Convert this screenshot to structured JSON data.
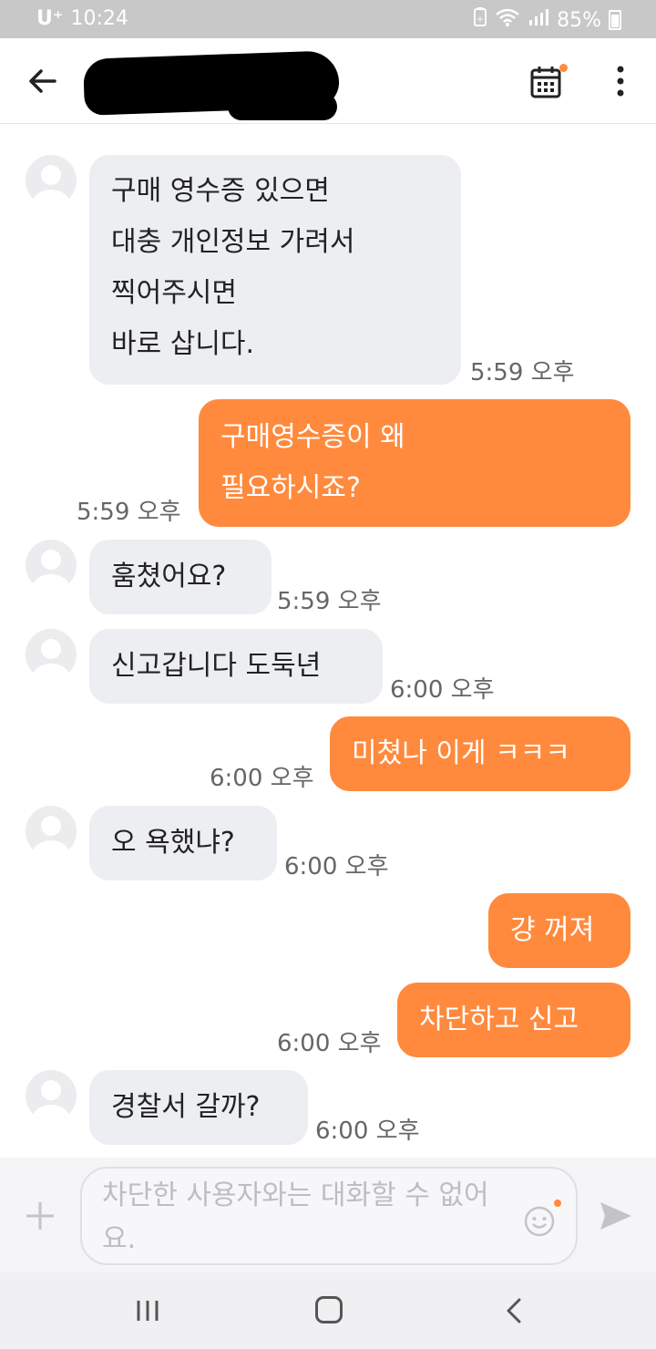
{
  "status_bar": {
    "carrier": "U⁺",
    "time": "10:24",
    "battery": "85%"
  },
  "header": {
    "back_label": "back",
    "title": ""
  },
  "messages": [
    {
      "side": "in",
      "text": "구매 영수증 있으면\n대충 개인정보 가려서\n찍어주시면\n바로 삽니다.",
      "time": "5:59 오후"
    },
    {
      "side": "out",
      "text": "구매영수증이 왜\n필요하시죠?",
      "time": "5:59 오후"
    },
    {
      "side": "in",
      "text": "훔쳤어요?",
      "time": "5:59 오후"
    },
    {
      "side": "in",
      "text": "신고갑니다 도둑년",
      "time": "6:00 오후"
    },
    {
      "side": "out",
      "text": "미쳤나 이게 ㅋㅋㅋ",
      "time": "6:00 오후"
    },
    {
      "side": "in",
      "text": "오 욕했냐?",
      "time": "6:00 오후"
    },
    {
      "side": "out",
      "text": "걍 꺼져",
      "time": ""
    },
    {
      "side": "out",
      "text": "차단하고 신고",
      "time": "6:00 오후"
    },
    {
      "side": "in",
      "text": "경찰서 갈까?",
      "time": "6:00 오후"
    }
  ],
  "input": {
    "placeholder": "차단한 사용자와는 대화할 수 없어요."
  },
  "colors": {
    "accent": "#ff8a3d",
    "incoming_bubble": "#eceef1",
    "status_bar": "#c8c8c8"
  },
  "icons": [
    "back-arrow-icon",
    "calendar-icon",
    "more-vertical-icon",
    "plus-icon",
    "emoji-icon",
    "send-icon",
    "nav-recent-icon",
    "nav-home-icon",
    "nav-back-icon"
  ]
}
